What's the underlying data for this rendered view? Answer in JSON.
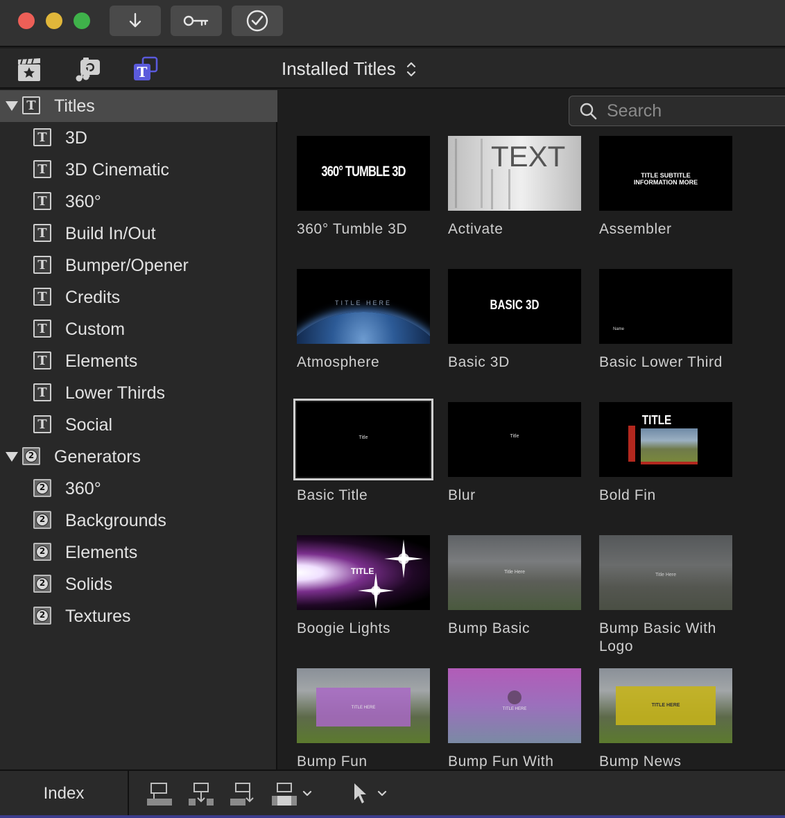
{
  "toolbar": {
    "import_icon": "down-arrow-icon",
    "keywords_icon": "key-icon",
    "background_tasks_icon": "checkmark-circle-icon"
  },
  "browser_header": {
    "tabs": [
      "media-browser-icon",
      "photos-audio-icon",
      "titles-generators-icon"
    ],
    "active_tab": "titles-generators-icon",
    "active_color": "#5a5adc",
    "source_label": "Installed Titles"
  },
  "sidebar": {
    "titles_group": {
      "label": "Titles",
      "items": [
        "3D",
        "3D Cinematic",
        "360°",
        "Build In/Out",
        "Bumper/Opener",
        "Credits",
        "Custom",
        "Elements",
        "Lower Thirds",
        "Social"
      ]
    },
    "generators_group": {
      "label": "Generators",
      "items": [
        "360°",
        "Backgrounds",
        "Elements",
        "Solids",
        "Textures"
      ]
    }
  },
  "search": {
    "placeholder": "Search"
  },
  "grid": {
    "tiles": [
      {
        "label": "360° Tumble 3D",
        "thumb_text": "360° TUMBLE 3D"
      },
      {
        "label": "Activate",
        "thumb_text": "TEXT"
      },
      {
        "label": "Assembler",
        "thumb_text": "TITLE SUBTITLE INFORMATION MORE"
      },
      {
        "label": "Atmosphere",
        "thumb_text": "TITLE HERE"
      },
      {
        "label": "Basic 3D",
        "thumb_text": "BASIC 3D"
      },
      {
        "label": "Basic Lower Third",
        "thumb_text": "Name"
      },
      {
        "label": "Basic Title",
        "thumb_text": "Title",
        "selected": true
      },
      {
        "label": "Blur",
        "thumb_text": "Title"
      },
      {
        "label": "Bold Fin",
        "thumb_text": "TITLE"
      },
      {
        "label": "Boogie Lights",
        "thumb_text": "TITLE"
      },
      {
        "label": "Bump Basic",
        "thumb_text": "Title Here"
      },
      {
        "label": "Bump Basic With Logo",
        "thumb_text": "Title Here"
      },
      {
        "label": "Bump Fun",
        "thumb_text": "TITLE HERE"
      },
      {
        "label": "Bump Fun With",
        "thumb_text": "TITLE HERE"
      },
      {
        "label": "Bump News",
        "thumb_text": "TITLE HERE"
      }
    ]
  },
  "bottom_bar": {
    "index_label": "Index",
    "edit_buttons": [
      "connect-clip-icon",
      "insert-clip-icon",
      "append-clip-icon",
      "overwrite-clip-icon"
    ],
    "tool": "select-arrow-icon"
  }
}
